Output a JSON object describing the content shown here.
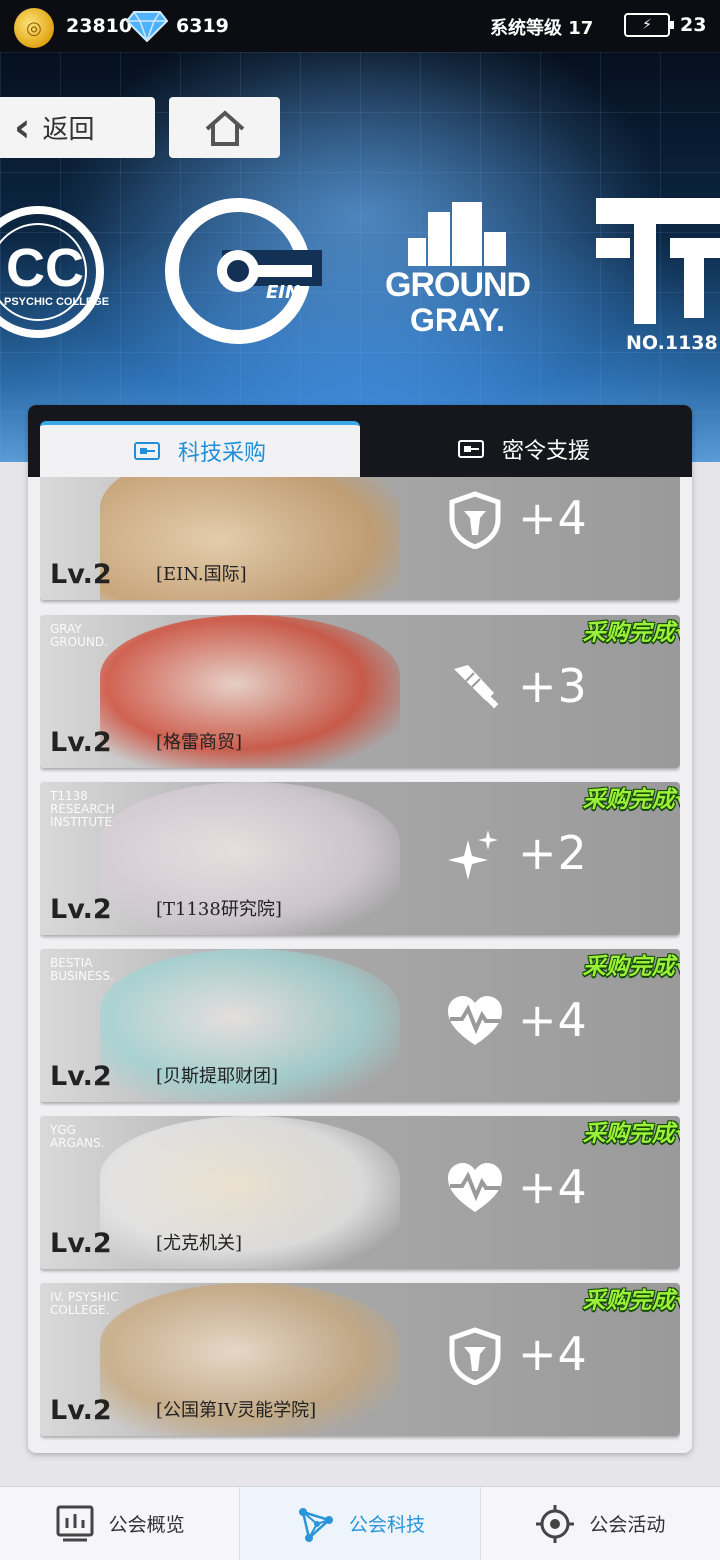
{
  "status_bar": {
    "coin_value": "23810",
    "gem_value": "6319",
    "system_level": "系统等级 17",
    "energy_value": "23"
  },
  "header": {
    "back_label": "返回"
  },
  "logos": {
    "psychic": "PSYCHIC COLLEGE",
    "ein": "EIN",
    "ground_gray_line1": "GROUND",
    "ground_gray_line2": "GRAY.",
    "t1138": "NO.1138"
  },
  "tabs": [
    {
      "label": "科技采购"
    },
    {
      "label": "密令支援"
    }
  ],
  "cards": [
    {
      "level": "Lv.2",
      "name": "[EIN.国际]",
      "tag": "",
      "icon": "shield-icon",
      "bonus": "+4",
      "completed": false
    },
    {
      "level": "Lv.2",
      "name": "[格雷商贸]",
      "tag": "GRAY\nGROUND.",
      "icon": "syringe-icon",
      "bonus": "+3",
      "completed": true,
      "done_label": "采购完成√"
    },
    {
      "level": "Lv.2",
      "name": "[T1138研究院]",
      "tag": "T1138\nRESEARCH\nINSTITUTE",
      "icon": "sparkle-icon",
      "bonus": "+2",
      "completed": true,
      "done_label": "采购完成√"
    },
    {
      "level": "Lv.2",
      "name": "[贝斯提耶财团]",
      "tag": "BESTIA\nBUSINESS.",
      "icon": "heart-pulse-icon",
      "bonus": "+4",
      "completed": true,
      "done_label": "采购完成√"
    },
    {
      "level": "Lv.2",
      "name": "[尤克机关]",
      "tag": "YGG\nARGANS.",
      "icon": "heart-pulse-icon",
      "bonus": "+4",
      "completed": true,
      "done_label": "采购完成√"
    },
    {
      "level": "Lv.2",
      "name": "[公国第IV灵能学院]",
      "tag": "IV. PSYSHIC\nCOLLEGE.",
      "icon": "shield-icon",
      "bonus": "+4",
      "completed": true,
      "done_label": "采购完成√"
    }
  ],
  "bottom_nav": [
    {
      "label": "公会概览",
      "icon": "chart-board-icon"
    },
    {
      "label": "公会科技",
      "icon": "network-icon",
      "active": true
    },
    {
      "label": "公会活动",
      "icon": "target-icon"
    }
  ],
  "colors": {
    "accent": "#2a95da",
    "done_badge": "#9cf03a"
  }
}
